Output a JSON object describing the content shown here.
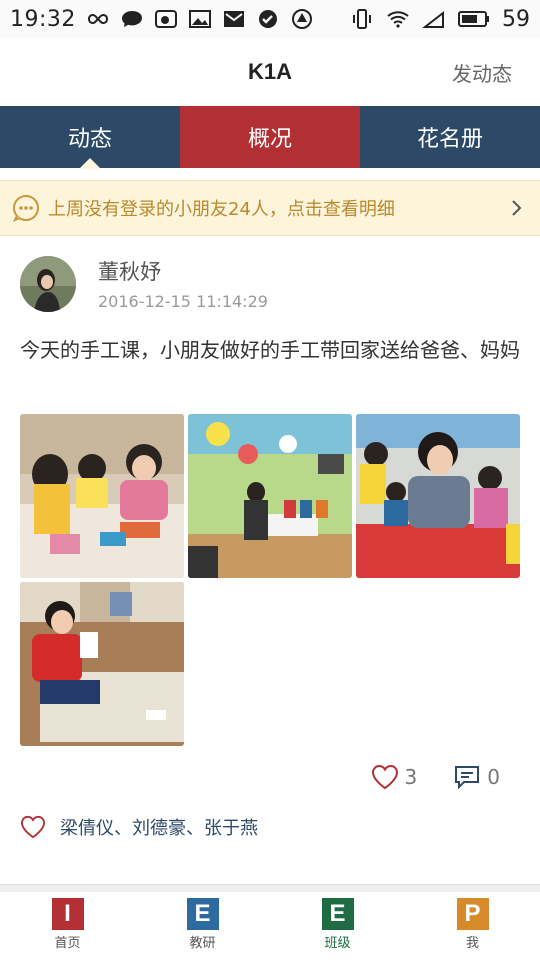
{
  "status_bar": {
    "time": "19:32",
    "battery": "59"
  },
  "header": {
    "title": "K1A",
    "action": "发动态"
  },
  "tabs": [
    {
      "label": "动态"
    },
    {
      "label": "概况"
    },
    {
      "label": "花名册"
    }
  ],
  "notice": {
    "text": "上周没有登录的小朋友24人，点击查看明细"
  },
  "post": {
    "author": "董秋妤",
    "time": "2016-12-15 11:14:29",
    "content": "今天的手工课，小朋友做好的手工带回家送给爸爸、妈妈",
    "photo_count": 4,
    "likes": "3",
    "comments": "0",
    "liked_by": "梁倩仪、刘德豪、张于燕"
  },
  "bottom_nav": [
    {
      "letter": "I",
      "label": "首页",
      "color": "#b22f34"
    },
    {
      "letter": "E",
      "label": "教研",
      "color": "#2d6aa0"
    },
    {
      "letter": "E",
      "label": "班级",
      "color": "#1e6b44"
    },
    {
      "letter": "P",
      "label": "我",
      "color": "#d68a2a"
    }
  ],
  "colors": {
    "tab_bg": "#2c4a68",
    "tab_active": "#b22f34",
    "notice_bg": "#fdf4dc",
    "notice_text": "#b98a2b",
    "liked_names": "#2c4a68"
  }
}
